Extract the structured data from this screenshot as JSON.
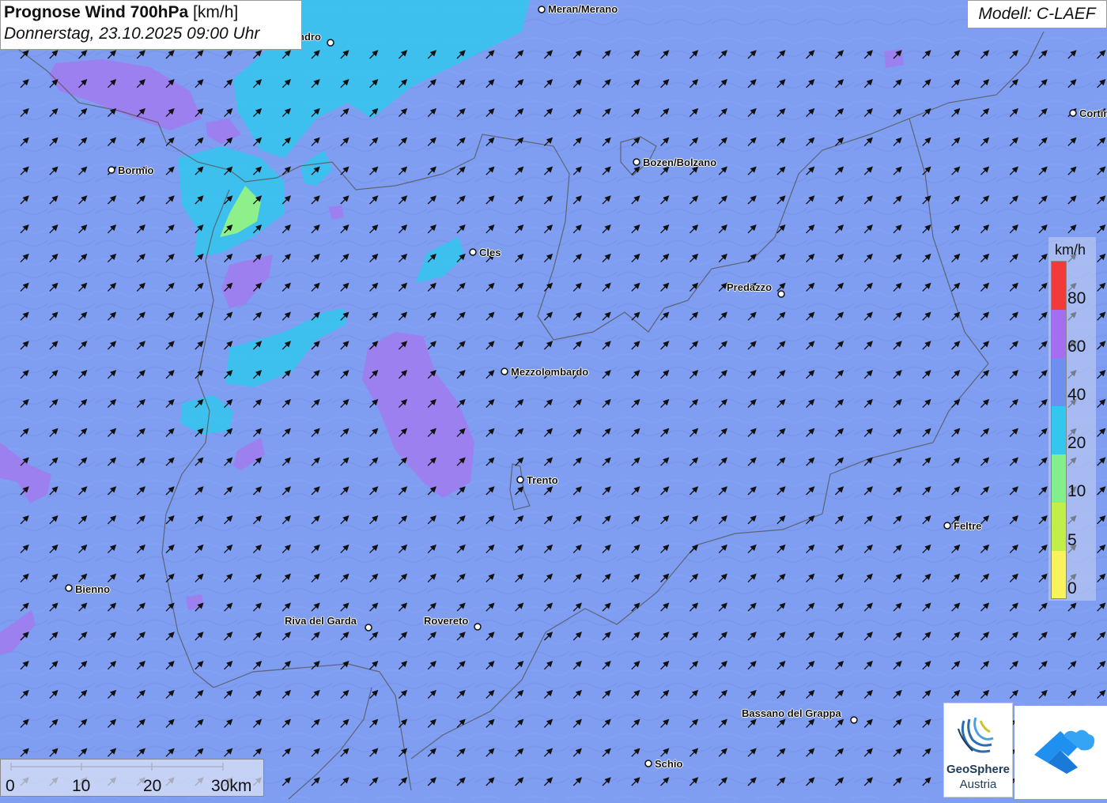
{
  "header": {
    "title_bold": "Prognose Wind 700hPa",
    "title_unit": " [km/h]",
    "date": "Donnerstag, 23.10.2025 09:00 Uhr",
    "model": "Modell: C-LAEF"
  },
  "cities": [
    {
      "name": "ndro"
    },
    {
      "name": "Meran/Merano"
    },
    {
      "name": "Bormio"
    },
    {
      "name": "Bozen/Bolzano"
    },
    {
      "name": "Cortin"
    },
    {
      "name": "Cles"
    },
    {
      "name": "Predazzo"
    },
    {
      "name": "Mezzolombardo"
    },
    {
      "name": "Trento"
    },
    {
      "name": "Feltre"
    },
    {
      "name": "Bienno"
    },
    {
      "name": "Riva del Garda"
    },
    {
      "name": "Rovereto"
    },
    {
      "name": "Bassano del Grappa"
    },
    {
      "name": "Schio"
    }
  ],
  "legend": {
    "unit": "km/h",
    "classes": [
      {
        "label": "80",
        "color": "#f23a3a"
      },
      {
        "label": "60",
        "color": "#a46ef0"
      },
      {
        "label": "40",
        "color": "#6e8ef0"
      },
      {
        "label": "20",
        "color": "#33c6ee"
      },
      {
        "label": "10",
        "color": "#82ee8c"
      },
      {
        "label": "5",
        "color": "#c2ee4a"
      },
      {
        "label": "0",
        "color": "#f8f35c"
      }
    ]
  },
  "scalebar": {
    "labels": [
      "0",
      "10",
      "20",
      "30km"
    ]
  },
  "logos": {
    "geosphere_line1": "GeoSphere",
    "geosphere_line2": "Austria"
  },
  "colors": {
    "background": "#7f9ef2",
    "purple": "#a07cf0",
    "cyan": "#33c6ee",
    "green": "#8ef08a"
  }
}
